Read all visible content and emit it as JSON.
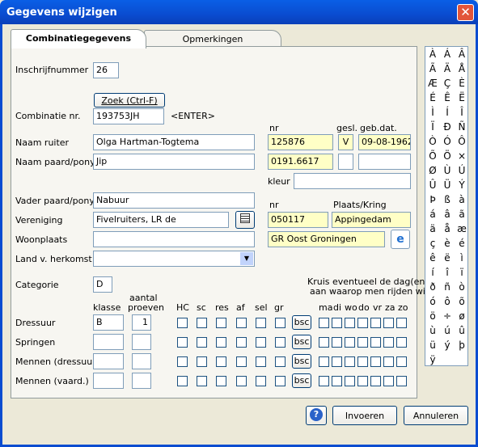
{
  "window": {
    "title": "Gegevens wijzigen",
    "close": "✕"
  },
  "tabs": [
    "Combinatiegegevens",
    "Opmerkingen"
  ],
  "labels": {
    "inschrijf": "Inschrijfnummer",
    "combinatie": "Combinatie nr.",
    "enter": "<ENTER>",
    "ruiter": "Naam ruiter",
    "paard": "Naam paard/pony",
    "vader": "Vader paard/pony",
    "vereniging": "Vereniging",
    "woonplaats": "Woonplaats",
    "land": "Land v. herkomst",
    "categorie": "Categorie",
    "nr": "nr",
    "gesl": "gesl.",
    "gebdat": "geb.dat.",
    "kleur": "kleur",
    "nr2": "nr",
    "plaats": "Plaats/Kring",
    "klasse": "klasse",
    "aantal": "aantal",
    "proeven": "proeven",
    "kruis1": "Kruis eventueel de dag(en)",
    "kruis2": "aan waarop men rijden wil"
  },
  "values": {
    "inschrijf": "26",
    "combinatie": "193753JH",
    "ruiter": "Olga Hartman-Togtema",
    "paard": "Jip",
    "vader": "Nabuur",
    "vereniging": "Fivelruiters, LR de",
    "woonplaats": "",
    "land": "",
    "categorie": "D",
    "ruiter_nr": "125876",
    "gesl": "V",
    "gebdat": "09-08-1962",
    "paard_nr": "0191.6617",
    "paard_gesl": "",
    "paard_geb": "",
    "kleur": "",
    "ver_nr": "050117",
    "plaats": "Appingedam",
    "kring": "GR Oost Groningen"
  },
  "zoek_label": "Zoek (Ctrl-F)",
  "cols": [
    "HC",
    "sc",
    "res",
    "af",
    "sel",
    "gr"
  ],
  "days": [
    "ma",
    "di",
    "wo",
    "do",
    "vr",
    "za",
    "zo"
  ],
  "disciplines": [
    {
      "name": "Dressuur",
      "klasse": "B",
      "aantal": "1"
    },
    {
      "name": "Springen",
      "klasse": "",
      "aantal": ""
    },
    {
      "name": "Mennen (dressuur)",
      "klasse": "",
      "aantal": ""
    },
    {
      "name": "Mennen (vaard.)",
      "klasse": "",
      "aantal": ""
    }
  ],
  "bsc": "bsc",
  "buttons": {
    "help": "?",
    "invoeren": "Invoeren",
    "annuleren": "Annuleren"
  },
  "chars": [
    "À",
    "Á",
    "Â",
    "Ã",
    "Ä",
    "Å",
    "Æ",
    "Ç",
    "È",
    "É",
    "Ê",
    "Ë",
    "Ì",
    "Í",
    "Î",
    "Ï",
    "Ð",
    "Ñ",
    "Ò",
    "Ó",
    "Ô",
    "Õ",
    "Ö",
    "×",
    "Ø",
    "Ù",
    "Ú",
    "Û",
    "Ü",
    "Ý",
    "Þ",
    "ß",
    "à",
    "á",
    "â",
    "ã",
    "ä",
    "å",
    "æ",
    "ç",
    "è",
    "é",
    "ê",
    "ë",
    "ì",
    "í",
    "î",
    "ï",
    "ð",
    "ñ",
    "ò",
    "ó",
    "ô",
    "õ",
    "ö",
    "÷",
    "ø",
    "ù",
    "ú",
    "û",
    "ü",
    "ý",
    "þ",
    "ÿ"
  ]
}
